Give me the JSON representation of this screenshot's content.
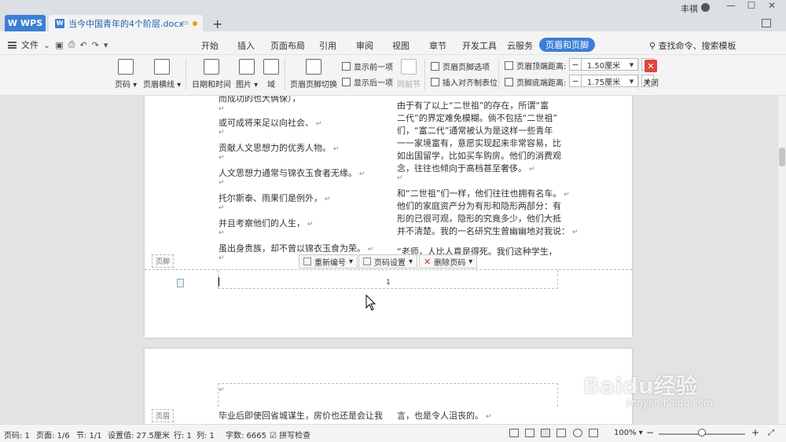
{
  "titlebar": {
    "wps_tab": "WPS",
    "doc_tab": "当今中国青年的4个阶层.docx",
    "new_tab": "+",
    "user_name": "丰祺",
    "min": "—",
    "max": "☐",
    "close": "✕"
  },
  "menubar": {
    "file": "文件",
    "items": [
      "开始",
      "插入",
      "页面布局",
      "引用",
      "审阅",
      "视图",
      "章节",
      "开发工具",
      "云服务",
      "页眉和页脚"
    ],
    "search": "查找命令、搜索模板"
  },
  "ribbon": {
    "page_number": "页码",
    "header_line": "页眉横线",
    "date_time": "日期和时间",
    "picture": "图片",
    "field": "域",
    "switch": "页眉页脚切换",
    "show_prev": "显示前一项",
    "show_next": "显示后一项",
    "same_as_prev": "同前节",
    "options": "页眉页脚选项",
    "insert_align_tab": "插入对齐制表位",
    "header_top_label": "页眉顶端距离:",
    "header_top_value": "1.50厘米",
    "footer_bottom_label": "页脚底端距离:",
    "footer_bottom_value": "1.75厘米",
    "close": "关闭"
  },
  "document": {
    "left_col": [
      "而成功的也大俩保），",
      "或可成将来足以向社会、",
      "贡献人文思想力的优秀人物。",
      "人文思想力通常与锦衣玉食者无缘。",
      "托尔斯泰、雨果们是例外，",
      "并且考察他们的人生，",
      "虽出身贵族，却不曾以锦衣玉食为荣。"
    ],
    "right_col": [
      "由于有了以上“二世祖”的存在，所谓“富",
      "二代”的界定难免模糊。倘不包括“二世祖”",
      "们，“富二代”通常被认为是这样一些青年",
      "一一家境富有，意愿实现起来非常容易，比",
      "如出国留学，比如买车购房。他们的消费观",
      "念，往往也倾向于高档甚至奢侈。",
      "和“二世祖”们一样，他们往往也拥有名车。",
      "他们的家庭资产分为有形和隐形两部分：有",
      "形的已很可观，隐形的究竟多少，他们大抵",
      "并不清楚。我的一名研究生曾幽幽地对我说：",
      "“老师，人比人真是得死。我们这种学生，"
    ],
    "footer_label": "页脚",
    "renumber": "重新编号",
    "page_setting": "页码设置",
    "delete_page_number": "删除页码",
    "page_number_value": "1",
    "header_label": "页眉",
    "page2_left": "毕业后即使回省城谋生，房价也还是会让我",
    "page2_right": "言，也是令人沮丧的。"
  },
  "statusbar": {
    "page": "页码: 1",
    "pages": "页面: 1/6",
    "section": "节: 1/1",
    "setting": "设置值: 27.5厘米",
    "row": "行: 1",
    "col": "列: 1",
    "words": "字数: 6665",
    "spell": "拼写检查",
    "zoom": "100%"
  },
  "watermark": {
    "brand": "Baidu经验",
    "url": "jingyan.baidu.com"
  }
}
